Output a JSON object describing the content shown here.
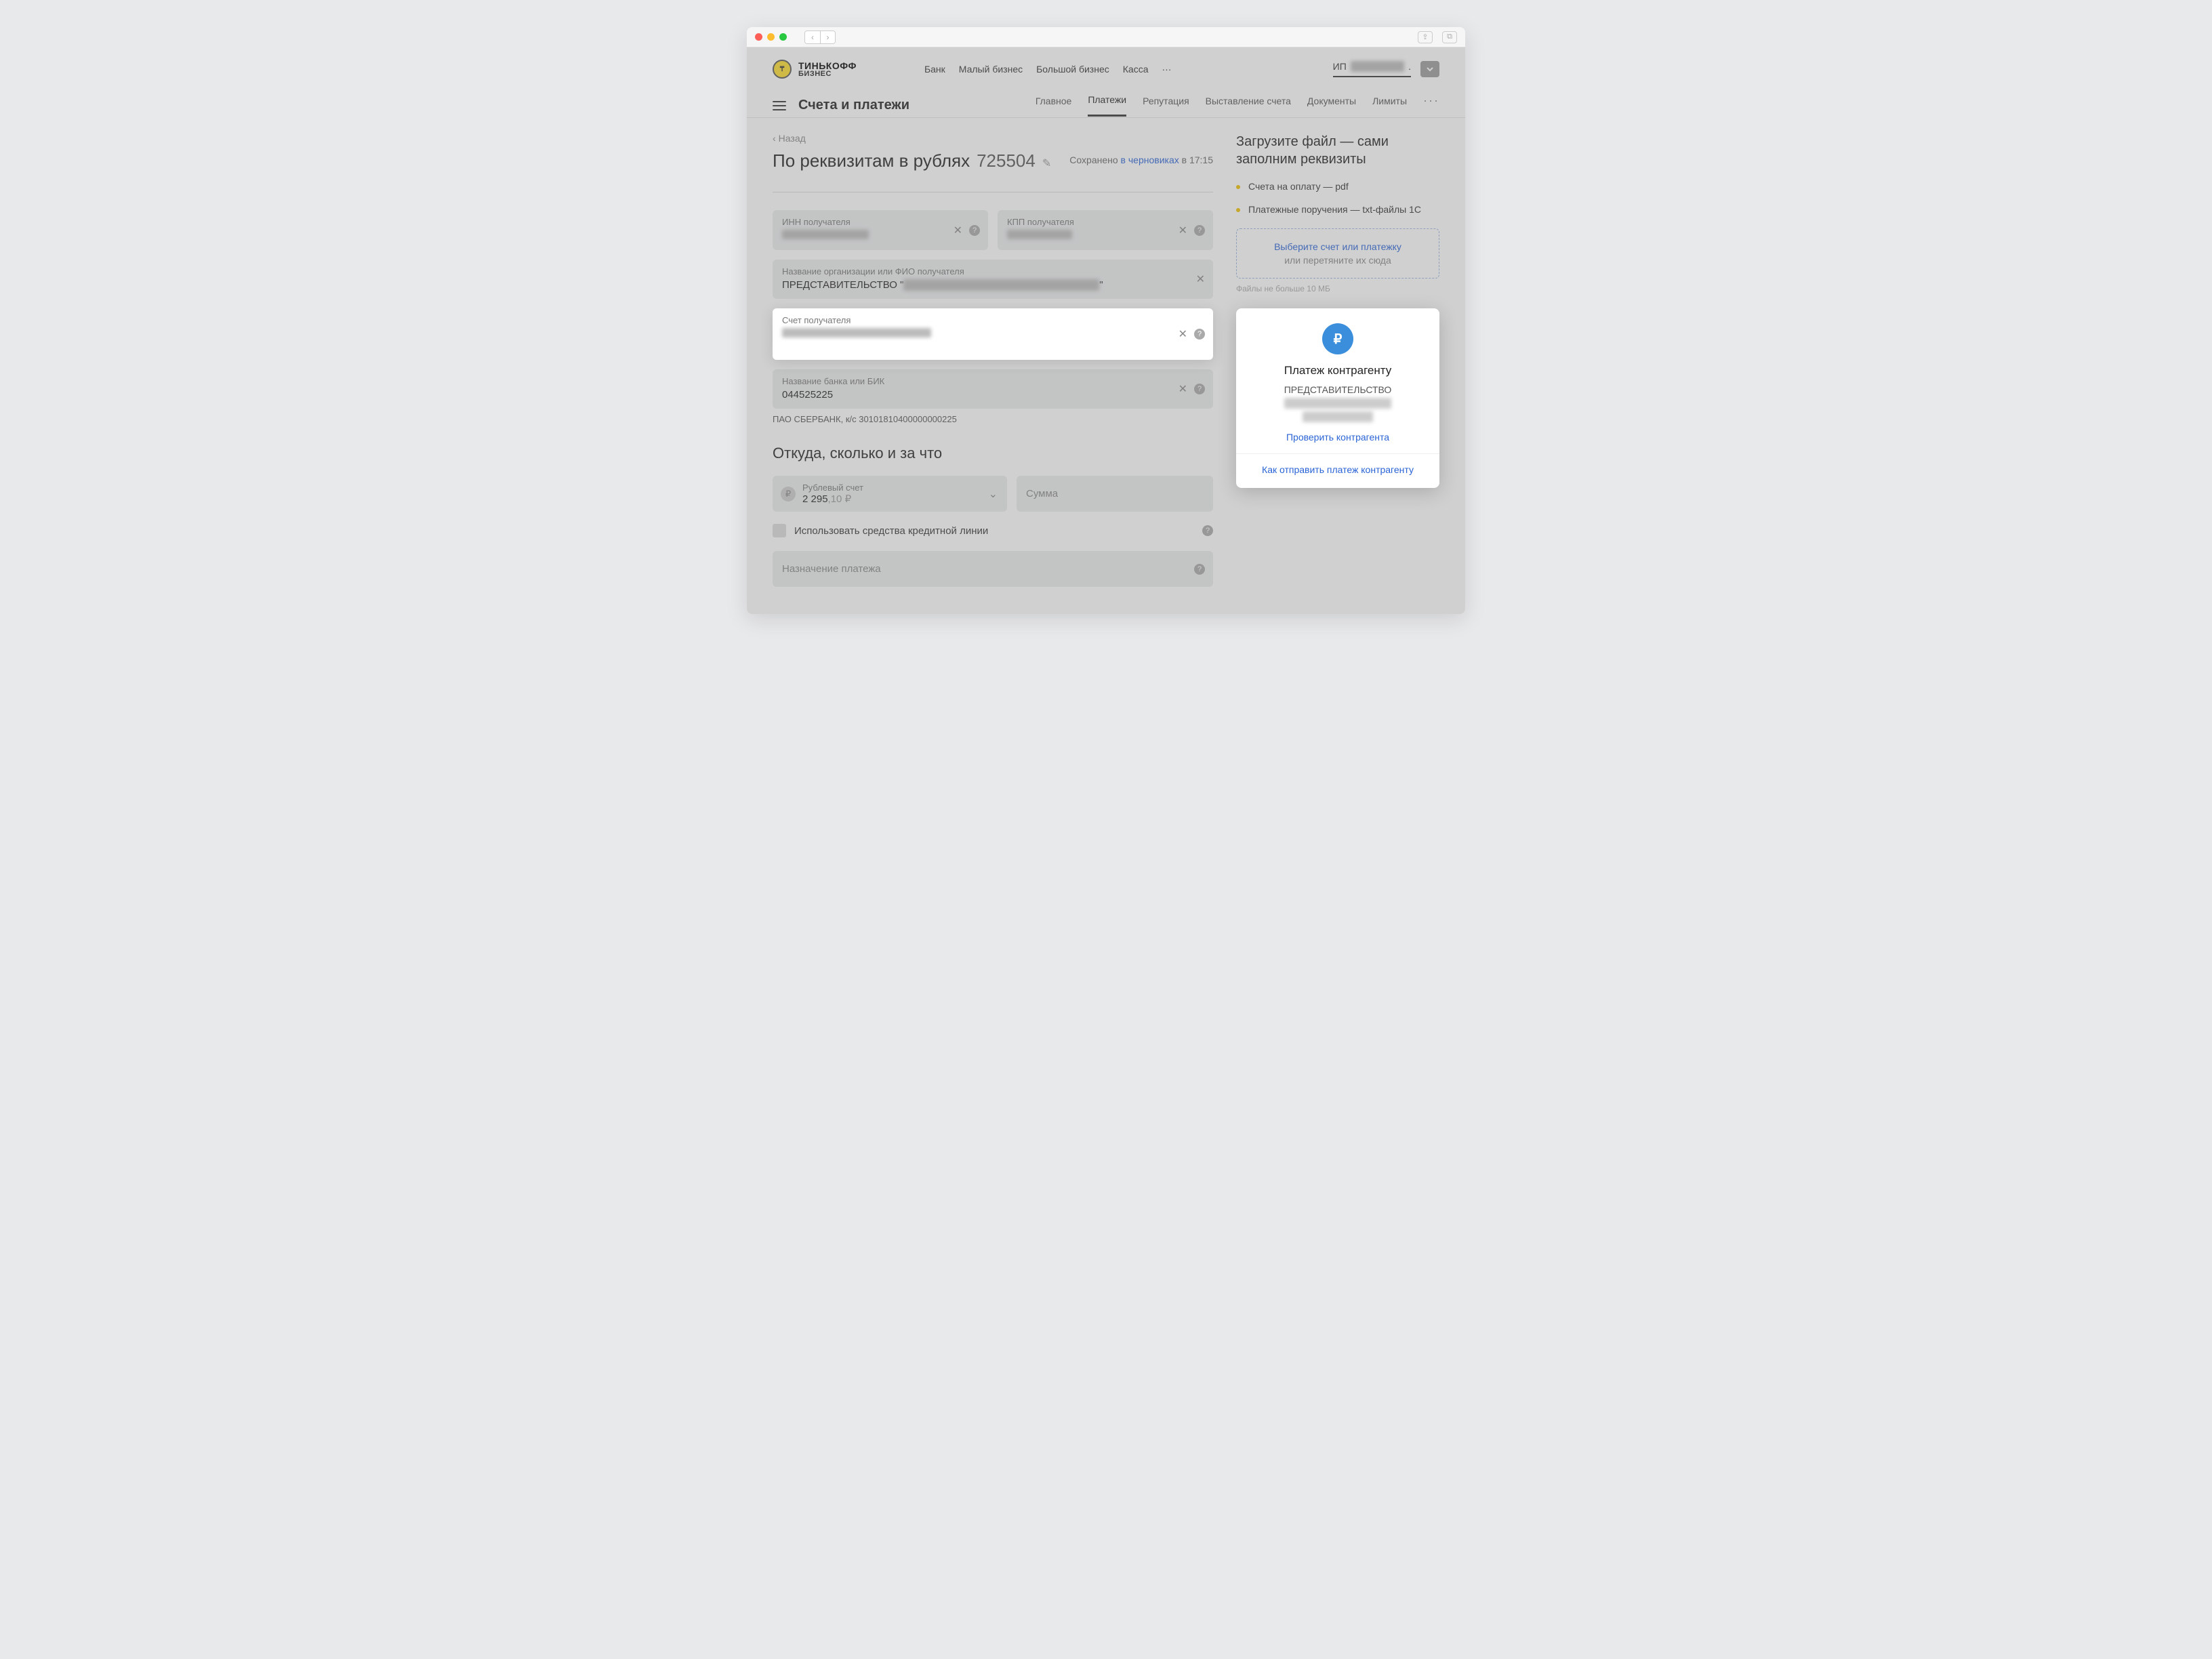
{
  "browser": {
    "back": "‹",
    "forward": "›"
  },
  "header": {
    "brand": "ТИНЬКОФФ",
    "sub": "БИЗНЕС",
    "nav": [
      "Банк",
      "Малый бизнес",
      "Большой бизнес",
      "Касса",
      "···"
    ],
    "user_prefix": "ИП",
    "user_masked": "████████",
    "user_suffix": "."
  },
  "subheader": {
    "section": "Счета и платежи",
    "tabs": [
      "Главное",
      "Платежи",
      "Репутация",
      "Выставление счета",
      "Документы",
      "Лимиты"
    ],
    "active_index": 1,
    "more": "···"
  },
  "page": {
    "back": "Назад",
    "title": "По реквизитам в рублях",
    "number": "725504",
    "saved_prefix": "Сохранено ",
    "saved_link": "в черновиках",
    "saved_suffix": " в 17:15"
  },
  "fields": {
    "inn_label": "ИНН получателя",
    "inn_value": "████████████",
    "kpp_label": "КПП получателя",
    "kpp_value": "█████████",
    "org_label": "Название организации или ФИО получателя",
    "org_prefix": "ПРЕДСТАВИТЕЛЬСТВО \"",
    "org_masked": "██████ ████ ██████ ██████████",
    "org_suffix": "\"",
    "account_label": "Счет получателя",
    "account_value": "█████ ████ █ █████  ██████████",
    "bank_label": "Название банка или БИК",
    "bank_value": "044525225",
    "bank_hint": "ПАО СБЕРБАНК, к/с 30101810400000000225"
  },
  "amount_section": {
    "heading": "Откуда, сколько и за что",
    "acct_label": "Рублевый счет",
    "acct_value_main": "2 295",
    "acct_value_frac": ",10 ₽",
    "sum_placeholder": "Сумма",
    "checkbox_label": "Использовать средства кредитной линии",
    "purpose_placeholder": "Назначение платежа"
  },
  "sidebar": {
    "upload_title": "Загрузите файл — сами заполним реквизиты",
    "bullets": [
      "Счета на оплату — pdf",
      "Платежные поручения — txt-файлы 1С"
    ],
    "drop_link": "Выберите счет или платежку",
    "drop_sub": "или перетяните их сюда",
    "files_hint": "Файлы не больше 10 МБ"
  },
  "card": {
    "icon_glyph": "₽",
    "title": "Платеж контрагенту",
    "sub_prefix": "ПРЕДСТАВИТЕЛЬСТВО",
    "sub_line2_mask": "\"██████████ █████",
    "sub_line3_mask": "██████████\"",
    "link1": "Проверить контрагента",
    "link2": "Как отправить платеж контрагенту"
  }
}
